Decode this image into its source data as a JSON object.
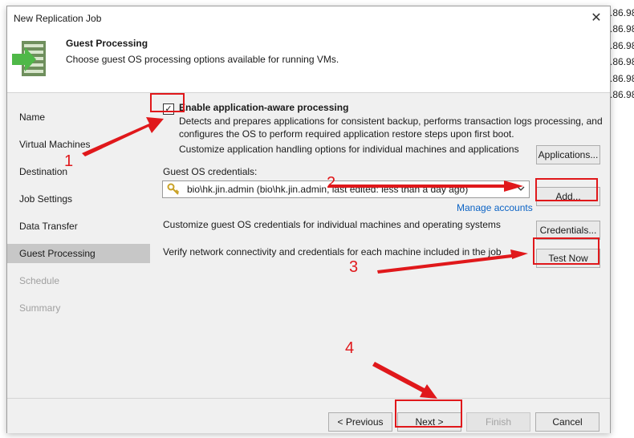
{
  "background": {
    "side_numbers": [
      ".86.98",
      ".86.98",
      ".86.98",
      ".86.98",
      ".86.98",
      ".86.98"
    ]
  },
  "window": {
    "title": "New Replication Job",
    "close_glyph": "✕"
  },
  "header": {
    "title": "Guest Processing",
    "subtitle": "Choose guest OS processing options available for running VMs.",
    "icon": "replication-wizard-icon"
  },
  "nav": {
    "items": [
      {
        "label": "Name",
        "state": "normal"
      },
      {
        "label": "Virtual Machines",
        "state": "normal"
      },
      {
        "label": "Destination",
        "state": "normal"
      },
      {
        "label": "Job Settings",
        "state": "normal"
      },
      {
        "label": "Data Transfer",
        "state": "normal"
      },
      {
        "label": "Guest Processing",
        "state": "active"
      },
      {
        "label": "Schedule",
        "state": "disabled"
      },
      {
        "label": "Summary",
        "state": "disabled"
      }
    ]
  },
  "guest": {
    "enable_checked": true,
    "check_glyph": "✓",
    "enable_label": "Enable application-aware processing",
    "description": "Detects and prepares applications for consistent backup, performs transaction logs processing, and configures the OS to perform required application restore steps upon first boot.",
    "customize_app_text": "Customize application handling options for individual machines and applications",
    "applications_button": "Applications...",
    "credentials_label": "Guest OS credentials:",
    "credentials_value": "bio\\hk.jin.admin (bio\\hk.jin.admin, last edited: less than a day ago)",
    "add_button": "Add...",
    "manage_accounts_link": "Manage accounts",
    "customize_cred_text": "Customize guest OS credentials for individual machines and operating systems",
    "credentials_button": "Credentials...",
    "verify_text": "Verify network connectivity and credentials for each machine included in the job",
    "test_now_button": "Test Now"
  },
  "footer": {
    "previous_button": "< Previous",
    "next_button": "Next >",
    "finish_button": "Finish",
    "cancel_button": "Cancel"
  },
  "annotations": {
    "numbers": [
      "1",
      "2",
      "3",
      "4"
    ],
    "color": "#e0181b"
  }
}
